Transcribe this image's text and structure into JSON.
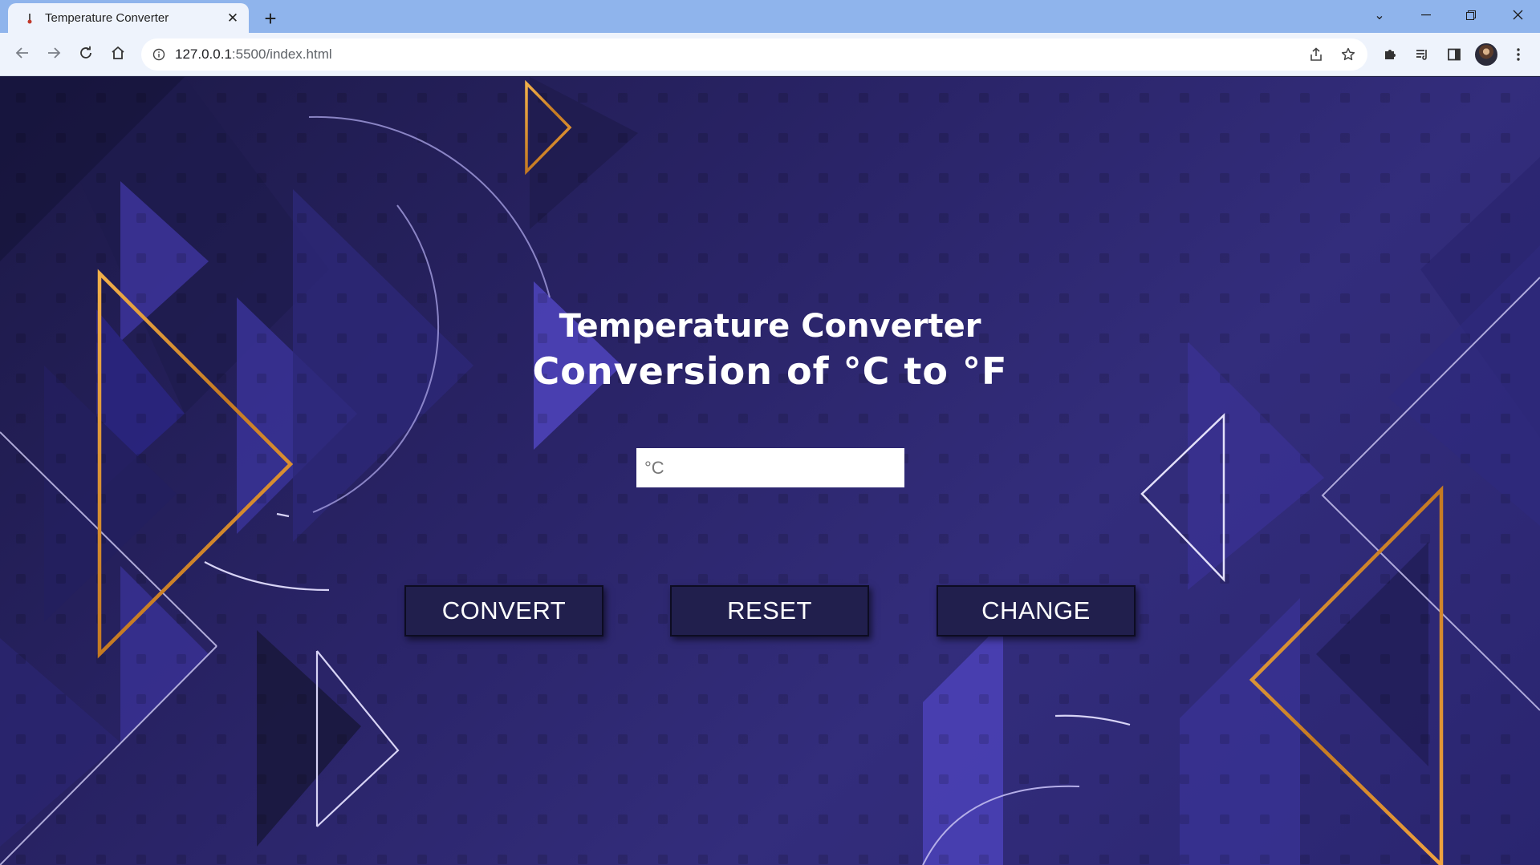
{
  "browser": {
    "tab": {
      "title": "Temperature Converter",
      "close_glyph": "✕"
    },
    "new_tab_glyph": "+",
    "window_controls": {
      "tab_search_glyph": "⌄",
      "minimize_glyph": "—",
      "restore_glyph": "❐",
      "close_glyph": "✕"
    },
    "address": {
      "host": "127.0.0.1",
      "path": ":5500/index.html"
    },
    "icons": {
      "back": "arrow-left-icon",
      "forward": "arrow-right-icon",
      "reload": "reload-icon",
      "home": "home-icon",
      "site_info": "info-circle-icon",
      "share": "share-icon",
      "bookmark": "star-icon",
      "extensions": "puzzle-icon",
      "reading_list": "reading-list-icon",
      "side_panel": "side-panel-icon",
      "profile": "avatar",
      "menu": "kebab-menu-icon"
    }
  },
  "app": {
    "title": "Temperature Converter",
    "subtitle": "Conversion of °C to °F",
    "input": {
      "placeholder": "°C",
      "value": ""
    },
    "buttons": {
      "convert": "CONVERT",
      "reset": "RESET",
      "change": "CHANGE"
    }
  },
  "colors": {
    "tabstrip": "#8fb4ec",
    "toolbar": "#eef3fc",
    "background_dark": "#1c1946",
    "background_light": "#332d7c",
    "accent_gold": "#e59a3a",
    "button_bg": "#211f4d"
  }
}
